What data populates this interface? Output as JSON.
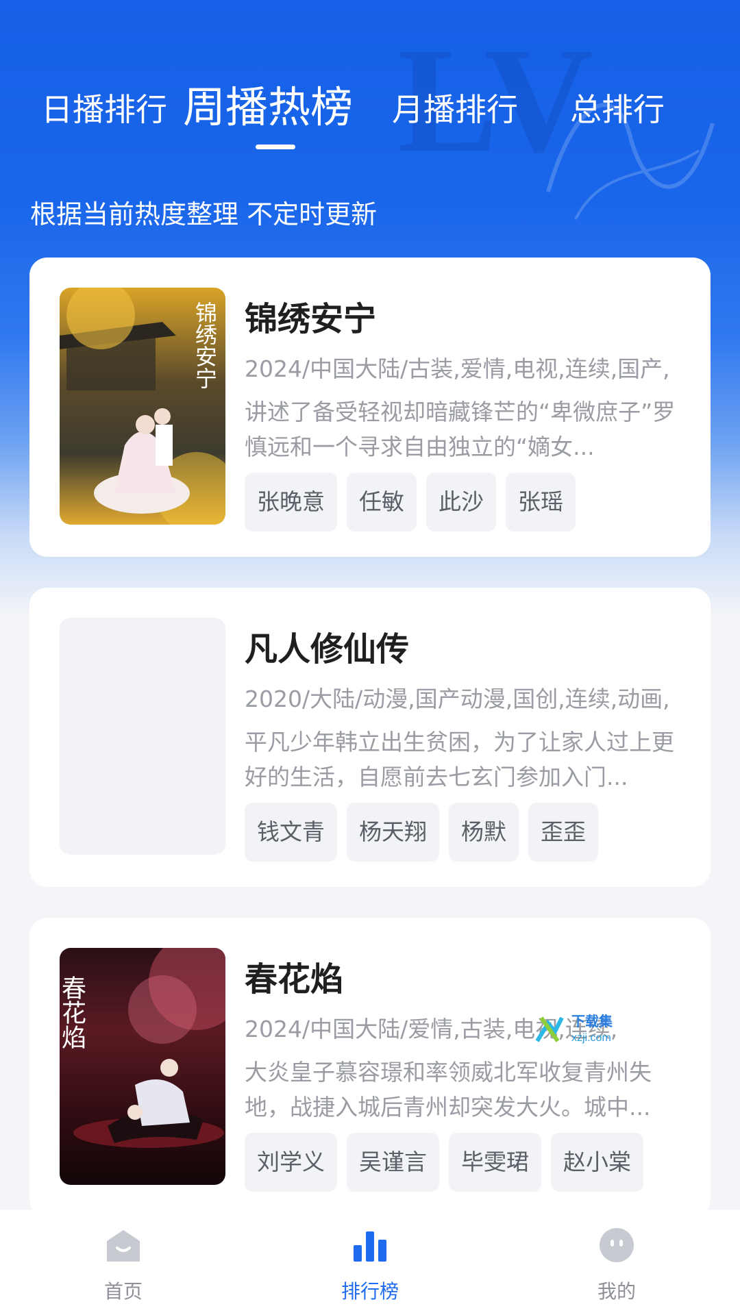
{
  "tabs": [
    {
      "label": "日播排行",
      "active": false
    },
    {
      "label": "周播热榜",
      "active": true
    },
    {
      "label": "月播排行",
      "active": false
    },
    {
      "label": "总排行",
      "active": false
    }
  ],
  "subtitle": "根据当前热度整理 不定时更新",
  "cards": [
    {
      "title": "锦绣安宁",
      "meta": "2024/中国大陆/古装,爱情,电视,连续,国产,",
      "desc": "讲述了备受轻视却暗藏锋芒的“卑微庶子”罗慎远和一个寻求自由独立的“嫡女...",
      "actors": [
        "张晚意",
        "任敏",
        "此沙",
        "张瑶"
      ],
      "poster_text": "锦绣安宁"
    },
    {
      "title": "凡人修仙传",
      "meta": "2020/大陆/动漫,国产动漫,国创,连续,动画,",
      "desc": "平凡少年韩立出生贫困，为了让家人过上更好的生活，自愿前去七玄门参加入门...",
      "actors": [
        "钱文青",
        "杨天翔",
        "杨默",
        "歪歪"
      ]
    },
    {
      "title": "春花焰",
      "meta": "2024/中国大陆/爱情,古装,电视,连续,",
      "desc": "大炎皇子慕容璟和率领威北军收复青州失地，战捷入城后青州却突发大火。城中...",
      "actors": [
        "刘学义",
        "吴谨言",
        "毕雯珺",
        "赵小棠"
      ],
      "poster_text": "春花焰"
    }
  ],
  "watermark": {
    "main": "下载集",
    "sub": "xzji.com"
  },
  "tabbar": [
    {
      "label": "首页",
      "icon": "home-icon",
      "active": false
    },
    {
      "label": "排行榜",
      "icon": "chart-icon",
      "active": true
    },
    {
      "label": "我的",
      "icon": "profile-icon",
      "active": false
    }
  ],
  "colors": {
    "accent": "#1f6bf0",
    "hero": "#1560e6",
    "chip_bg": "#f2f3f6",
    "text_muted": "#9a9ca3"
  }
}
